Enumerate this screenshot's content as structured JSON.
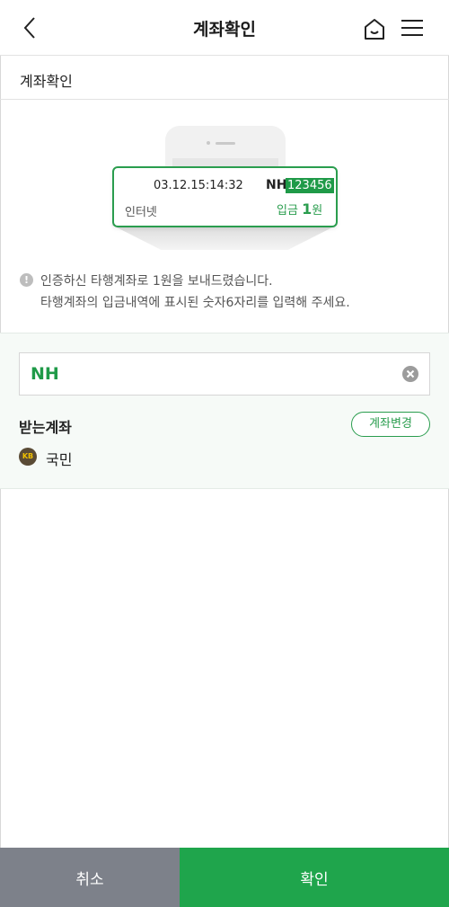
{
  "header": {
    "title": "계좌확인",
    "back_icon": "chevron-left-icon",
    "home_icon": "home-icon",
    "menu_icon": "hamburger-menu-icon"
  },
  "sub_title": "계좌확인",
  "illustration": {
    "time": "03.12.15:14:32",
    "bank": "NH",
    "code": "123456",
    "channel": "인터넷",
    "deposit_prefix": "입금",
    "deposit_amount": "1",
    "deposit_unit": "원"
  },
  "notice": {
    "line1": "인증하신 타행계좌로 1원을 보내드렸습니다.",
    "line2": "타행계좌의 입금내역에 표시된 숫자6자리를 입력해 주세요."
  },
  "code_field": {
    "prefix": "NH",
    "value": "",
    "placeholder": ""
  },
  "receive": {
    "label": "받는계좌",
    "change_button": "계좌변경",
    "bank_logo_text": "KB",
    "bank_name": "국민"
  },
  "buttons": {
    "cancel": "취소",
    "confirm": "확인"
  },
  "colors": {
    "accent": "#1fa54c",
    "cancel": "#7d818a",
    "panel_bg": "#f6faf7"
  }
}
